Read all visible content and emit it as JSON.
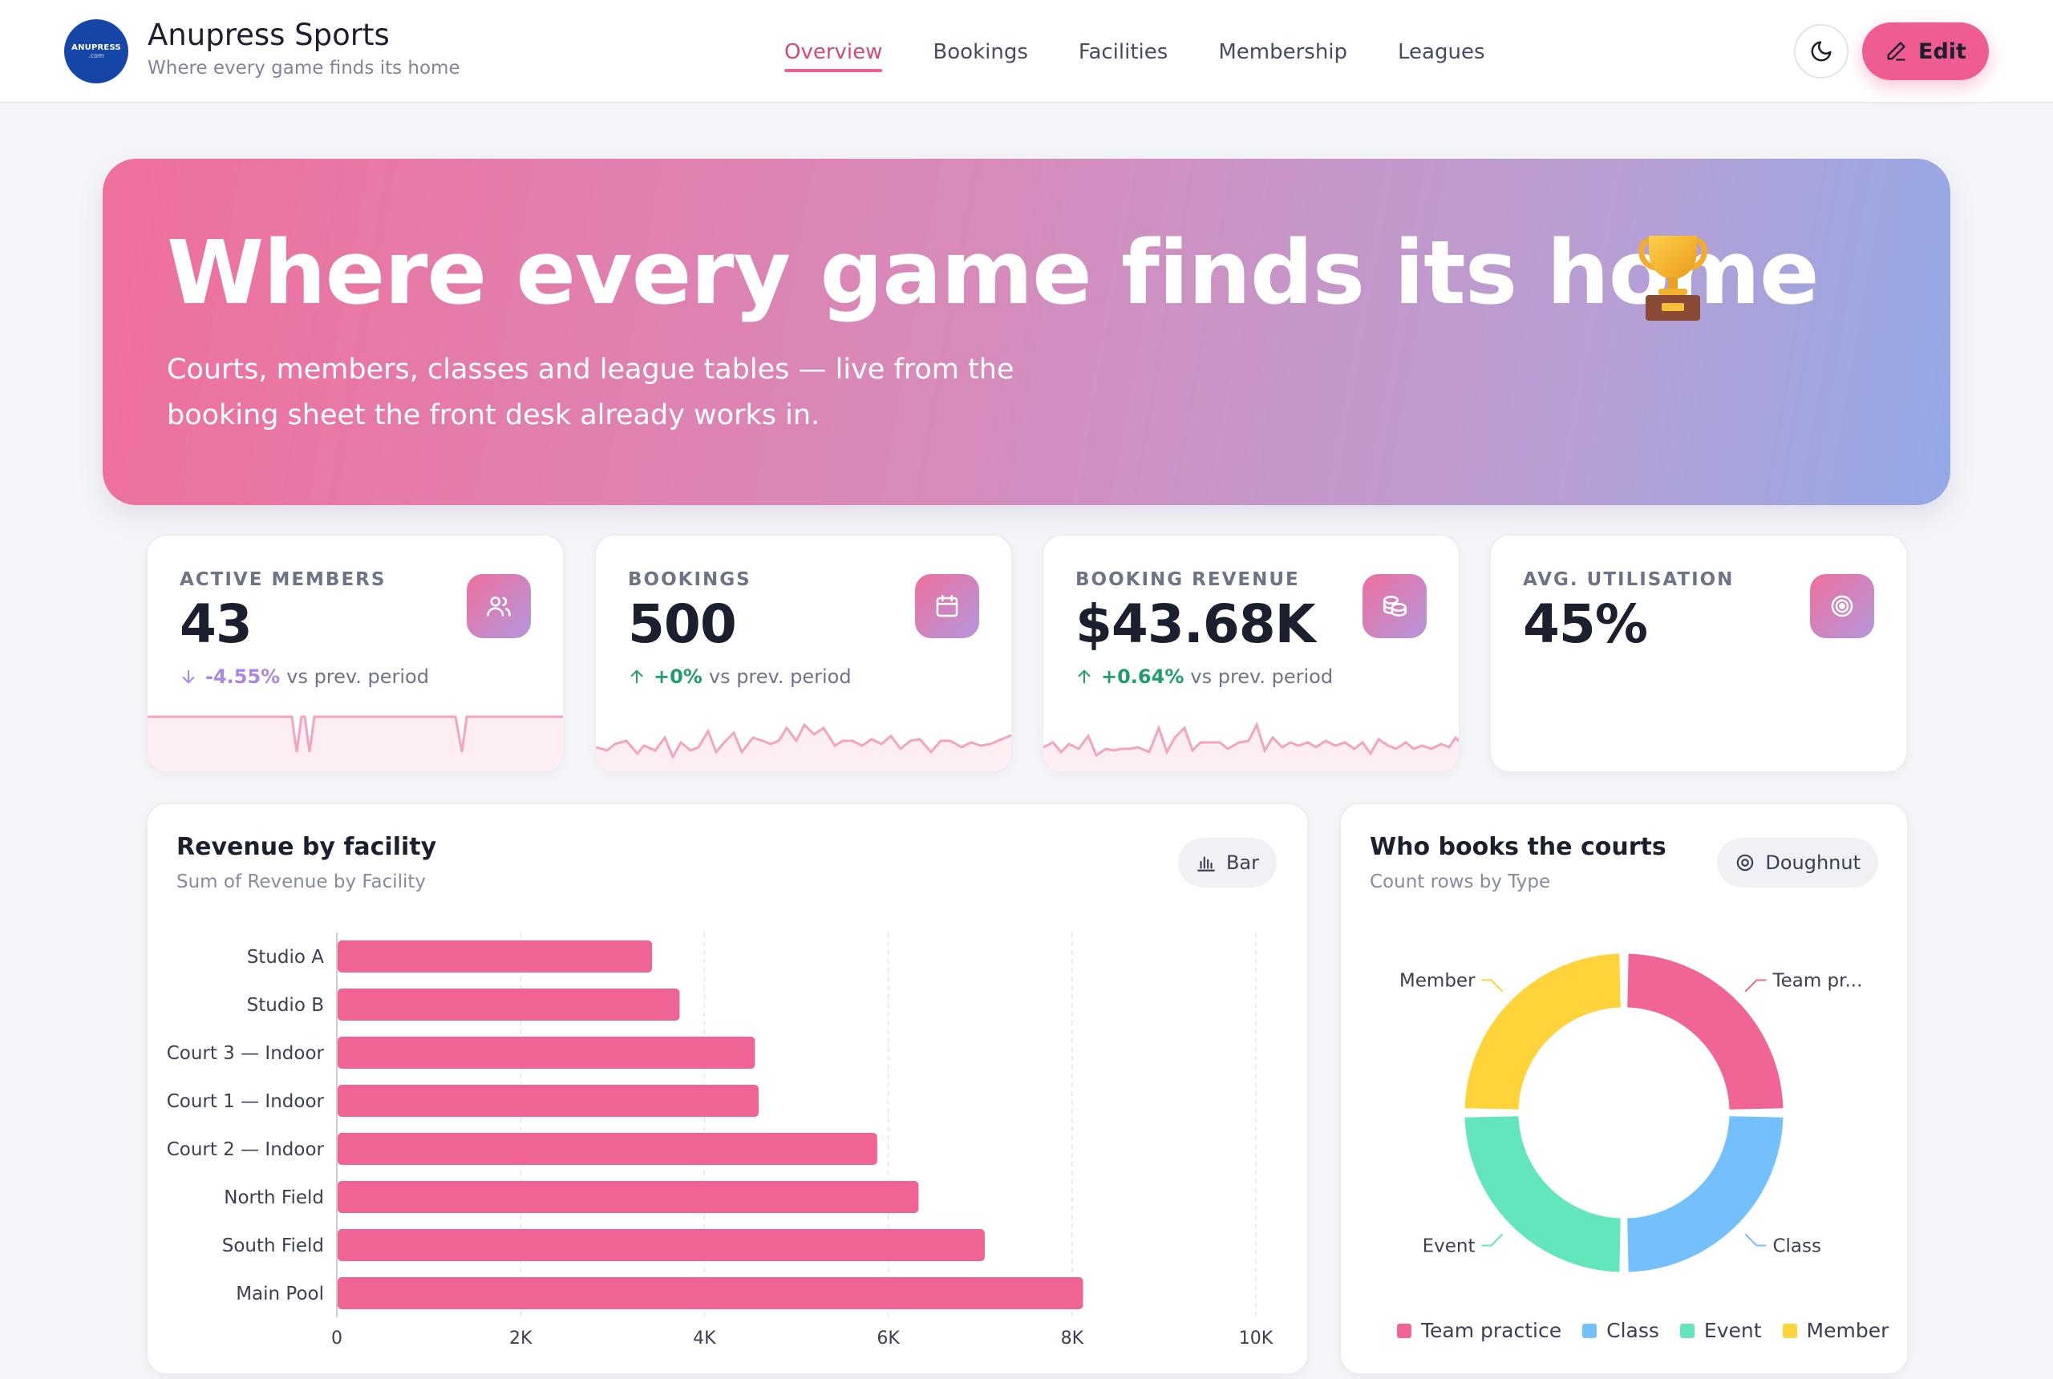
{
  "header": {
    "logo_text": "ANUPRESS",
    "logo_subtext": ".com",
    "brand_title": "Anupress Sports",
    "brand_subtitle": "Where every game finds its home",
    "nav": [
      {
        "label": "Overview",
        "active": true
      },
      {
        "label": "Bookings",
        "active": false
      },
      {
        "label": "Facilities",
        "active": false
      },
      {
        "label": "Membership",
        "active": false
      },
      {
        "label": "Leagues",
        "active": false
      }
    ],
    "theme_icon": "moon-icon",
    "edit_label": "Edit",
    "edit_icon": "pencil-icon"
  },
  "hero": {
    "title": "Where every game finds its home",
    "emoji": "trophy-icon",
    "subtitle": "Courts, members, classes and league tables — live from the booking sheet the front desk already works in."
  },
  "kpis": [
    {
      "label": "ACTIVE MEMBERS",
      "value": "43",
      "icon": "users-icon",
      "trend_dir": "down",
      "trend_pct": "-4.55%",
      "trend_text": "vs prev. period"
    },
    {
      "label": "BOOKINGS",
      "value": "500",
      "icon": "calendar-icon",
      "trend_dir": "up",
      "trend_pct": "+0%",
      "trend_text": "vs prev. period"
    },
    {
      "label": "BOOKING REVENUE",
      "value": "$43.68K",
      "icon": "coins-icon",
      "trend_dir": "up",
      "trend_pct": "+0.64%",
      "trend_text": "vs prev. period"
    },
    {
      "label": "AVG. UTILISATION",
      "value": "45%",
      "icon": "target-icon"
    }
  ],
  "revenue_panel": {
    "title": "Revenue by facility",
    "subtitle": "Sum of Revenue by Facility",
    "chip_label": "Bar",
    "chip_icon": "bar-chart-icon"
  },
  "type_panel": {
    "title": "Who books the courts",
    "subtitle": "Count rows by Type",
    "chip_label": "Doughnut",
    "chip_icon": "doughnut-icon",
    "slice_labels": [
      "Team pr...",
      "Class",
      "Event",
      "Member"
    ]
  },
  "colors": {
    "accent": "#ef5c92",
    "bar": "#ef6495",
    "team_practice": "#f06595",
    "class": "#74c0fc",
    "event": "#63e6be",
    "member": "#ffd43b"
  },
  "chart_data": [
    {
      "type": "bar",
      "orientation": "horizontal",
      "title": "Revenue by facility",
      "subtitle": "Sum of Revenue by Facility",
      "categories": [
        "Studio A",
        "Studio B",
        "Court 3 — Indoor",
        "Court 1 — Indoor",
        "Court 2 — Indoor",
        "North Field",
        "South Field",
        "Main Pool"
      ],
      "values": [
        3430,
        3730,
        4550,
        4590,
        5880,
        6330,
        7050,
        8120
      ],
      "xlim": [
        0,
        10000
      ],
      "xticks": [
        "0",
        "2K",
        "4K",
        "6K",
        "8K",
        "10K"
      ],
      "tick_values": [
        0,
        2000,
        4000,
        6000,
        8000,
        10000
      ],
      "grid": true,
      "legend": "none"
    },
    {
      "type": "pie",
      "variant": "doughnut",
      "title": "Who books the courts",
      "subtitle": "Count rows by Type",
      "categories": [
        "Team practice",
        "Class",
        "Event",
        "Member"
      ],
      "values": [
        125,
        125,
        125,
        125
      ],
      "legend": "bottom"
    }
  ]
}
